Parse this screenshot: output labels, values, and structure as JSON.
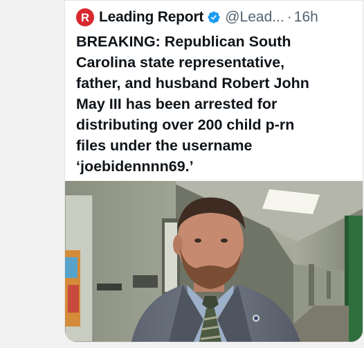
{
  "tweet": {
    "account_name": "Leading Report",
    "logo_letter": "R",
    "handle": "@Lead...",
    "separator": "·",
    "time": "16h",
    "text_lines": [
      "BREAKING: Republican South",
      "Carolina state representative,",
      "father, and husband Robert John",
      "May III has been arrested for",
      "distributing over 200 child p-rn",
      "files under the username",
      "‘joebidennnn69.’"
    ]
  },
  "colors": {
    "brand_red": "#d9272e",
    "verified_blue": "#1d9bf0",
    "text_primary": "#0f1419",
    "text_secondary": "#536471"
  },
  "icons": {
    "verified": "verified-badge-icon",
    "logo": "leading-report-logo-icon"
  }
}
